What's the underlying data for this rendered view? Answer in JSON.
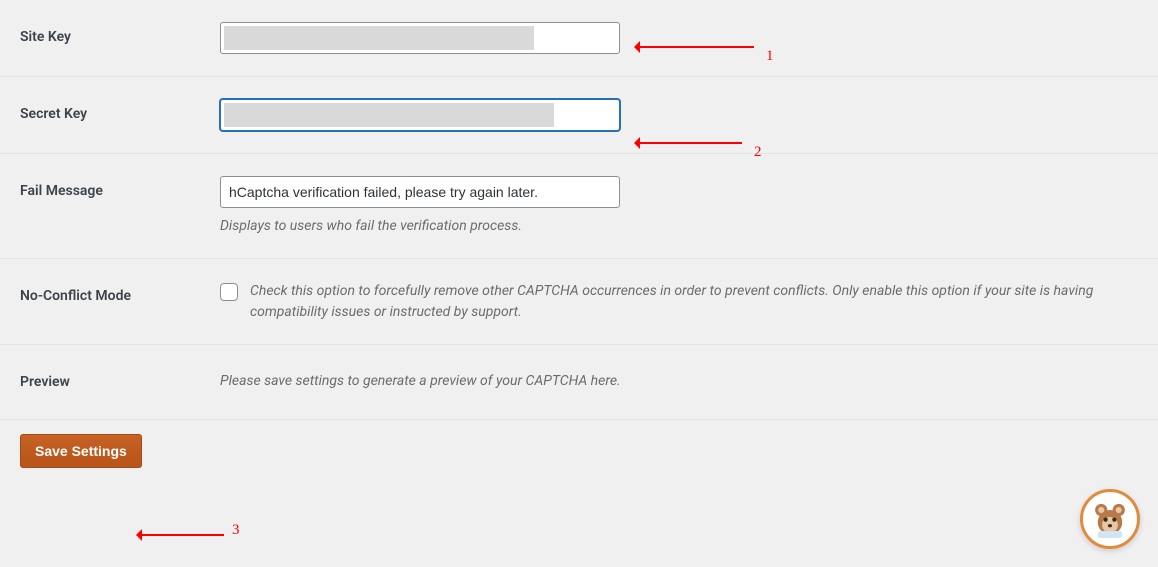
{
  "fields": {
    "site_key": {
      "label": "Site Key",
      "value": ""
    },
    "secret_key": {
      "label": "Secret Key",
      "value": ""
    },
    "fail_message": {
      "label": "Fail Message",
      "value": "hCaptcha verification failed, please try again later.",
      "description": "Displays to users who fail the verification process."
    },
    "no_conflict": {
      "label": "No-Conflict Mode",
      "checked": false,
      "description": "Check this option to forcefully remove other CAPTCHA occurrences in order to prevent conflicts. Only enable this option if your site is having compatibility issues or instructed by support."
    },
    "preview": {
      "label": "Preview",
      "description": "Please save settings to generate a preview of your CAPTCHA here."
    }
  },
  "actions": {
    "save": "Save Settings"
  },
  "annotations": {
    "n1": "1",
    "n2": "2",
    "n3": "3"
  },
  "colors": {
    "accent": "#c05a1a",
    "annotation": "#ff0000",
    "focus": "#2271b1"
  }
}
